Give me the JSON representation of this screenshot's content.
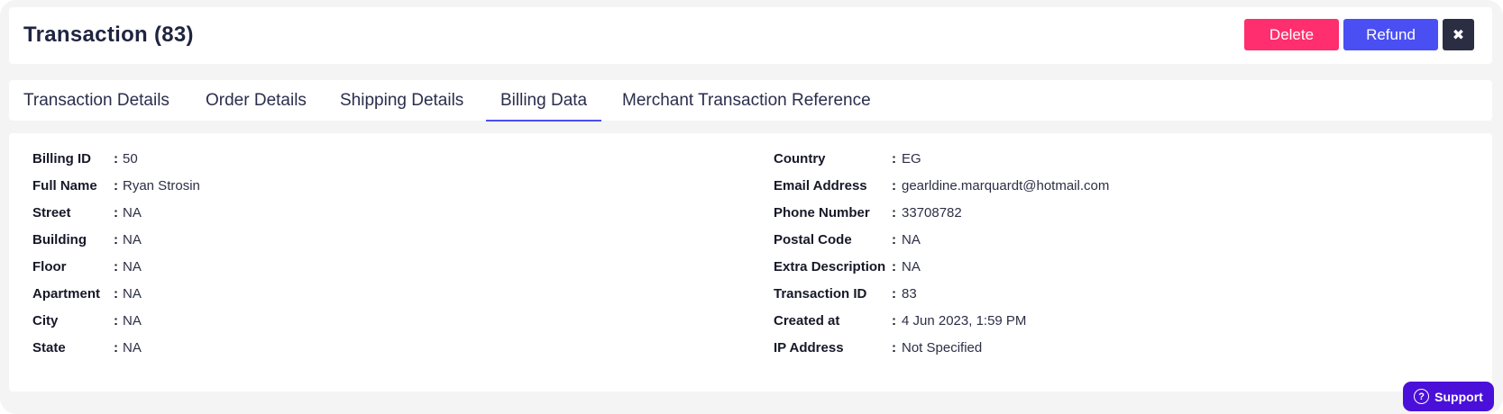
{
  "header": {
    "title": "Transaction (83)",
    "delete_label": "Delete",
    "refund_label": "Refund",
    "close_glyph": "✖"
  },
  "tabs": [
    {
      "label": "Transaction Details",
      "active": false
    },
    {
      "label": "Order Details",
      "active": false
    },
    {
      "label": "Shipping Details",
      "active": false
    },
    {
      "label": "Billing Data",
      "active": true
    },
    {
      "label": "Merchant Transaction Reference",
      "active": false
    }
  ],
  "billing": {
    "left": [
      {
        "label": "Billing ID",
        "value": "50"
      },
      {
        "label": "Full Name",
        "value": "Ryan Strosin"
      },
      {
        "label": "Street",
        "value": "NA"
      },
      {
        "label": "Building",
        "value": "NA"
      },
      {
        "label": "Floor",
        "value": "NA"
      },
      {
        "label": "Apartment",
        "value": "NA"
      },
      {
        "label": "City",
        "value": "NA"
      },
      {
        "label": "State",
        "value": "NA"
      }
    ],
    "right": [
      {
        "label": "Country",
        "value": "EG"
      },
      {
        "label": "Email Address",
        "value": "gearldine.marquardt@hotmail.com"
      },
      {
        "label": "Phone Number",
        "value": "33708782"
      },
      {
        "label": "Postal Code",
        "value": "NA"
      },
      {
        "label": "Extra Description",
        "value": "NA"
      },
      {
        "label": "Transaction ID",
        "value": "83"
      },
      {
        "label": "Created at",
        "value": "4 Jun 2023, 1:59 PM"
      },
      {
        "label": "IP Address",
        "value": "Not Specified"
      }
    ],
    "separator": ":"
  },
  "support": {
    "label": "Support",
    "icon_glyph": "?"
  },
  "colors": {
    "delete": "#ff2e6e",
    "refund": "#4a4ff3",
    "close": "#2b2d42",
    "active_tab_underline": "#4a4ff3",
    "support": "#4a10d9"
  }
}
